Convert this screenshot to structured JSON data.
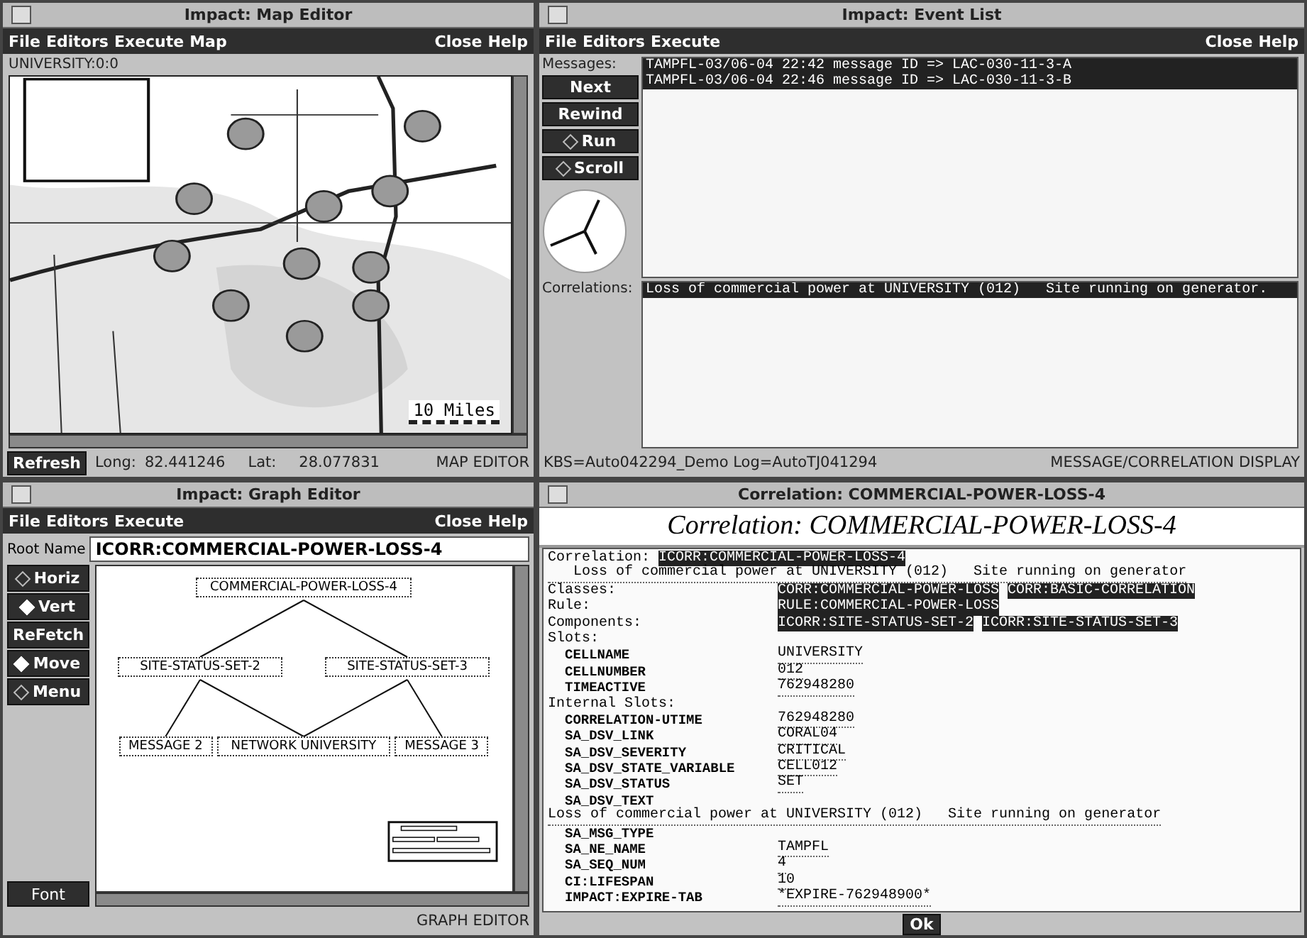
{
  "map_editor": {
    "title": "Impact: Map Editor",
    "menu_left": [
      "File",
      "Editors",
      "Execute",
      "Map"
    ],
    "menu_right": [
      "Close",
      "Help"
    ],
    "location_label": "UNIVERSITY:0:0",
    "scale_label": "10 Miles",
    "refresh_button": "Refresh",
    "long_label": "Long:",
    "long_value": "82.441246",
    "lat_label": "Lat:",
    "lat_value": "28.077831",
    "mode_label": "MAP EDITOR"
  },
  "event_list": {
    "title": "Impact: Event List",
    "menu_left": [
      "File",
      "Editors",
      "Execute"
    ],
    "menu_right": [
      "Close",
      "Help"
    ],
    "messages_label": "Messages:",
    "buttons": [
      {
        "label": "Next",
        "kind": "push"
      },
      {
        "label": "Rewind",
        "kind": "push"
      },
      {
        "label": "Run",
        "kind": "toggle",
        "selected": false
      },
      {
        "label": "Scroll",
        "kind": "toggle",
        "selected": false
      }
    ],
    "messages": [
      {
        "text": "TAMPFL-03/06-04 22:42 message ID => LAC-030-11-3-A",
        "selected": true
      },
      {
        "text": "TAMPFL-03/06-04 22:46 message ID => LAC-030-11-3-B",
        "selected": true
      }
    ],
    "correlations_label": "Correlations:",
    "correlations": [
      {
        "text": "Loss of commercial power at UNIVERSITY (012)   Site running on generator.",
        "selected": true
      }
    ],
    "status_left": "KBS=Auto042294_Demo Log=AutoTJ041294",
    "status_right": "MESSAGE/CORRELATION DISPLAY"
  },
  "graph_editor": {
    "title": "Impact: Graph Editor",
    "menu_left": [
      "File",
      "Editors",
      "Execute"
    ],
    "menu_right": [
      "Close",
      "Help"
    ],
    "root_name_label": "Root Name",
    "root_name_value": "ICORR:COMMERCIAL-POWER-LOSS-4",
    "buttons": [
      {
        "label": "Horiz",
        "kind": "toggle",
        "selected": false
      },
      {
        "label": "Vert",
        "kind": "toggle",
        "selected": true
      },
      {
        "label": "ReFetch",
        "kind": "push"
      },
      {
        "label": "Move",
        "kind": "toggle",
        "selected": true
      },
      {
        "label": "Menu",
        "kind": "toggle",
        "selected": false
      }
    ],
    "font_button": "Font",
    "graph_rows": [
      [
        {
          "label": "COMMERCIAL-POWER-LOSS-4"
        }
      ],
      [
        {
          "label": "SITE-STATUS-SET-2",
          "links": [
            true
          ]
        },
        {
          "label": "SITE-STATUS-SET-3",
          "links": [
            true
          ]
        }
      ],
      [
        {
          "label": "MESSAGE 2",
          "links": [
            true,
            false
          ]
        },
        {
          "label": "NETWORK UNIVERSITY",
          "links": [
            true,
            true
          ]
        },
        {
          "label": "MESSAGE 3",
          "links": [
            false,
            true
          ]
        }
      ]
    ],
    "mode_label": "GRAPH EDITOR"
  },
  "correlation_window": {
    "title": "Correlation: COMMERCIAL-POWER-LOSS-4",
    "heading": "Correlation: COMMERCIAL-POWER-LOSS-4",
    "lines": [
      {
        "kind": "inline",
        "label": "Correlation:",
        "values": [
          {
            "text": "ICORR:COMMERCIAL-POWER-LOSS-4",
            "highlighted": true
          }
        ]
      },
      {
        "kind": "text",
        "indent": true,
        "text": "Loss of commercial power at UNIVERSITY (012)   Site running on generator"
      },
      {
        "kind": "field",
        "label": "Classes:",
        "values": [
          {
            "text": "CORR:COMMERCIAL-POWER-LOSS",
            "highlighted": true
          },
          {
            "text": "CORR:BASIC-CORRELATION",
            "highlighted": true
          }
        ]
      },
      {
        "kind": "field",
        "label": "Rule:",
        "values": [
          {
            "text": "RULE:COMMERCIAL-POWER-LOSS",
            "highlighted": true
          }
        ]
      },
      {
        "kind": "field",
        "label": "Components:",
        "values": [
          {
            "text": "ICORR:SITE-STATUS-SET-2",
            "highlighted": true
          },
          {
            "text": "ICORR:SITE-STATUS-SET-3",
            "highlighted": true
          }
        ]
      },
      {
        "kind": "section",
        "label": "Slots:"
      },
      {
        "kind": "slot",
        "label": "CELLNAME",
        "values": [
          {
            "text": "UNIVERSITY",
            "highlighted": false
          }
        ]
      },
      {
        "kind": "slot",
        "label": "CELLNUMBER",
        "values": [
          {
            "text": "012",
            "highlighted": false
          }
        ]
      },
      {
        "kind": "slot",
        "label": "TIMEACTIVE",
        "values": [
          {
            "text": "762948280",
            "highlighted": false
          }
        ]
      },
      {
        "kind": "section",
        "label": "Internal Slots:"
      },
      {
        "kind": "slot",
        "label": "CORRELATION-UTIME",
        "values": [
          {
            "text": "762948280",
            "highlighted": false
          }
        ]
      },
      {
        "kind": "slot",
        "label": "SA_DSV_LINK",
        "values": [
          {
            "text": "CORAL04",
            "highlighted": false
          }
        ]
      },
      {
        "kind": "slot",
        "label": "SA_DSV_SEVERITY",
        "values": [
          {
            "text": "CRITICAL",
            "highlighted": false
          }
        ]
      },
      {
        "kind": "slot",
        "label": "SA_DSV_STATE_VARIABLE",
        "values": [
          {
            "text": "CELL012",
            "highlighted": false
          }
        ]
      },
      {
        "kind": "slot",
        "label": "SA_DSV_STATUS",
        "values": [
          {
            "text": "SET",
            "highlighted": false
          }
        ]
      },
      {
        "kind": "slot",
        "label": "SA_DSV_TEXT"
      },
      {
        "kind": "text",
        "indent": false,
        "text": "Loss of commercial power at UNIVERSITY (012)   Site running on generator"
      },
      {
        "kind": "slot",
        "label": "SA_MSG_TYPE"
      },
      {
        "kind": "slot",
        "label": "SA_NE_NAME",
        "values": [
          {
            "text": "TAMPFL",
            "highlighted": false
          }
        ]
      },
      {
        "kind": "slot",
        "label": "SA_SEQ_NUM",
        "values": [
          {
            "text": "4",
            "highlighted": false
          }
        ]
      },
      {
        "kind": "slot",
        "label": "CI:LIFESPAN",
        "values": [
          {
            "text": "10",
            "highlighted": false
          }
        ]
      },
      {
        "kind": "slot",
        "label": "IMPACT:EXPIRE-TAB",
        "values": [
          {
            "text": "*EXPIRE-762948900*",
            "highlighted": false
          }
        ]
      }
    ],
    "ok_button": "Ok"
  }
}
